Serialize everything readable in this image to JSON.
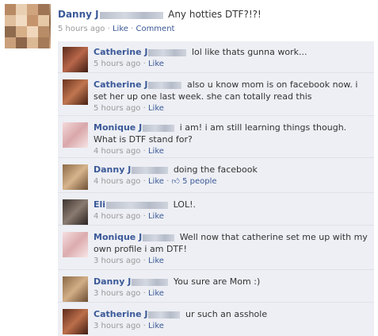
{
  "post": {
    "author": "Danny J",
    "status": "Any hotties DTF?!?!",
    "time": "5 hours ago",
    "like": "Like",
    "comment": "Comment"
  },
  "comments": [
    {
      "author": "Catherine J",
      "text": "lol like thats gunna work...",
      "time": "5 hours ago",
      "like": "Like",
      "avatar_color": "#7a3a24"
    },
    {
      "author": "Catherine J",
      "text": "also u know mom is on facebook now. i set her up one last week. she can totally read this",
      "time": "5 hours ago",
      "like": "Like",
      "avatar_color": "#8a4a2e"
    },
    {
      "author": "Monique J",
      "text": "i am! i am still learning things though. What is DTF stand for?",
      "time": "4 hours ago",
      "like": "Like",
      "avatar_color": "#e6c2c4"
    },
    {
      "author": "Danny J",
      "text": "doing the facebook",
      "time": "4 hours ago",
      "like": "Like",
      "likes_count": "5 people",
      "avatar_color": "#b08a62"
    },
    {
      "author": "Eli",
      "text": "LOL!.",
      "time": "4 hours ago",
      "like": "Like",
      "avatar_color": "#5a4e48"
    },
    {
      "author": "Monique J",
      "text": "Well now that catherine set me up with my own profile i am DTF!",
      "time": "3 hours ago",
      "like": "Like",
      "avatar_color": "#e8c7c8"
    },
    {
      "author": "Danny J",
      "text": "You sure are Mom :)",
      "time": "3 hours ago",
      "like": "Like",
      "avatar_color": "#a88660"
    },
    {
      "author": "Catherine J",
      "text": "ur such an asshole",
      "time": "3 hours ago",
      "like": "Like",
      "avatar_color": "#7d3e26"
    }
  ]
}
